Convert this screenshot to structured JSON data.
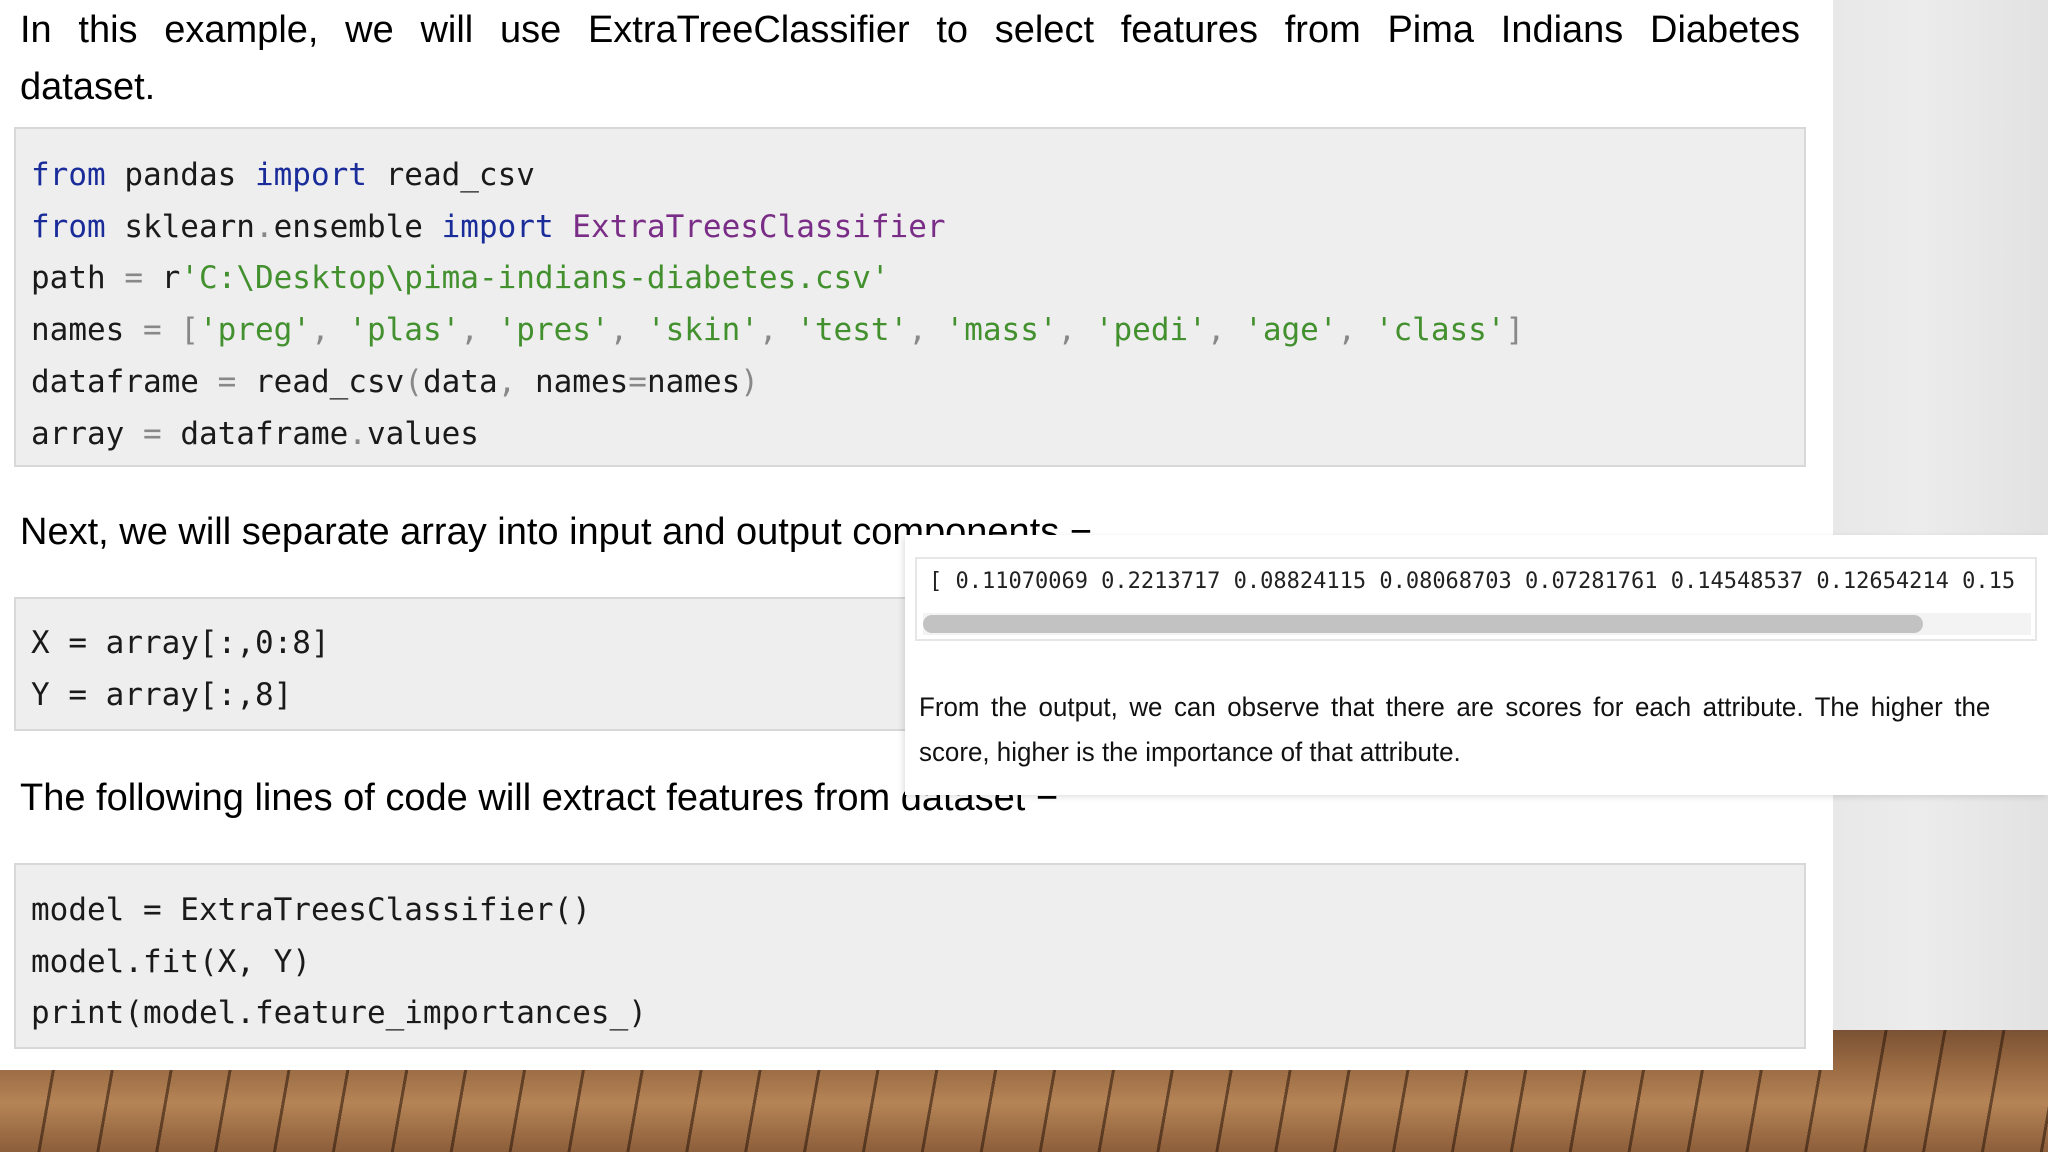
{
  "intro": {
    "line1": "In this example, we will use ExtraTreeClassifier to select features from Pima Indians Diabetes",
    "line2": "dataset."
  },
  "code_block_1": {
    "lines": [
      [
        {
          "t": "from",
          "c": "kw"
        },
        {
          "t": " pandas ",
          "c": ""
        },
        {
          "t": "import",
          "c": "kw"
        },
        {
          "t": " read_csv",
          "c": ""
        }
      ],
      [
        {
          "t": "from",
          "c": "kw"
        },
        {
          "t": " sklearn",
          "c": ""
        },
        {
          "t": ".",
          "c": "op"
        },
        {
          "t": "ensemble ",
          "c": ""
        },
        {
          "t": "import",
          "c": "kw"
        },
        {
          "t": " ",
          "c": ""
        },
        {
          "t": "ExtraTreesClassifier",
          "c": "cls"
        }
      ],
      [
        {
          "t": "path ",
          "c": ""
        },
        {
          "t": "=",
          "c": "op"
        },
        {
          "t": " r",
          "c": ""
        },
        {
          "t": "'C:\\Desktop\\pima-indians-diabetes.csv'",
          "c": "str"
        }
      ],
      [
        {
          "t": "names ",
          "c": ""
        },
        {
          "t": "= [",
          "c": "op"
        },
        {
          "t": "'preg'",
          "c": "str"
        },
        {
          "t": ", ",
          "c": "op"
        },
        {
          "t": "'plas'",
          "c": "str"
        },
        {
          "t": ", ",
          "c": "op"
        },
        {
          "t": "'pres'",
          "c": "str"
        },
        {
          "t": ", ",
          "c": "op"
        },
        {
          "t": "'skin'",
          "c": "str"
        },
        {
          "t": ", ",
          "c": "op"
        },
        {
          "t": "'test'",
          "c": "str"
        },
        {
          "t": ", ",
          "c": "op"
        },
        {
          "t": "'mass'",
          "c": "str"
        },
        {
          "t": ", ",
          "c": "op"
        },
        {
          "t": "'pedi'",
          "c": "str"
        },
        {
          "t": ", ",
          "c": "op"
        },
        {
          "t": "'age'",
          "c": "str"
        },
        {
          "t": ", ",
          "c": "op"
        },
        {
          "t": "'class'",
          "c": "str"
        },
        {
          "t": "]",
          "c": "op"
        }
      ],
      [
        {
          "t": "dataframe ",
          "c": ""
        },
        {
          "t": "=",
          "c": "op"
        },
        {
          "t": " read_csv",
          "c": ""
        },
        {
          "t": "(",
          "c": "op"
        },
        {
          "t": "data",
          "c": ""
        },
        {
          "t": ",",
          "c": "op"
        },
        {
          "t": " names",
          "c": ""
        },
        {
          "t": "=",
          "c": "op"
        },
        {
          "t": "names",
          "c": ""
        },
        {
          "t": ")",
          "c": "op"
        }
      ],
      [
        {
          "t": "array ",
          "c": ""
        },
        {
          "t": "=",
          "c": "op"
        },
        {
          "t": " dataframe",
          "c": ""
        },
        {
          "t": ".",
          "c": "op"
        },
        {
          "t": "values",
          "c": ""
        }
      ]
    ]
  },
  "next_text": "Next, we will separate array into input and output components −",
  "code_block_2": {
    "lines": [
      "X = array[:,0:8]",
      "Y = array[:,8]"
    ]
  },
  "following_text": "The following lines of code will extract features from dataset −",
  "code_block_3": {
    "lines": [
      "model = ExtraTreesClassifier()",
      "model.fit(X, Y)",
      "print(model.feature_importances_)"
    ]
  },
  "output_panel": {
    "output_text": "[ 0.11070069 0.2213717 0.08824115 0.08068703 0.07281761 0.14548537 0.12654214 0.15",
    "caption": "From the output, we can observe that there are scores for each attribute. The higher the score, higher is the importance of that attribute."
  },
  "colors": {
    "keyword": "#1a2c9a",
    "class_name": "#7a2d87",
    "string": "#43902f",
    "operator": "#888888",
    "code_background": "#eeeeee"
  }
}
